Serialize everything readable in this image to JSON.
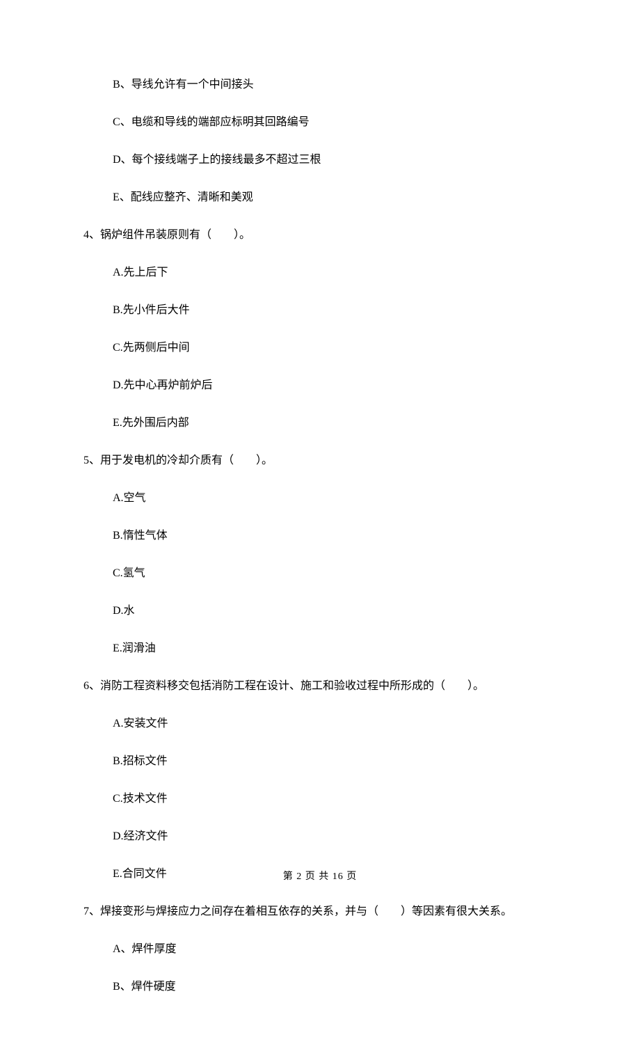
{
  "options_top": [
    "B、导线允许有一个中间接头",
    "C、电缆和导线的端部应标明其回路编号",
    "D、每个接线端子上的接线最多不超过三根",
    "E、配线应整齐、清晰和美观"
  ],
  "q4": {
    "text": "4、锅炉组件吊装原则有（　　）。",
    "opts": [
      "A.先上后下",
      "B.先小件后大件",
      "C.先两侧后中间",
      "D.先中心再炉前炉后",
      "E.先外围后内部"
    ]
  },
  "q5": {
    "text": "5、用于发电机的冷却介质有（　　）。",
    "opts": [
      "A.空气",
      "B.惰性气体",
      "C.氢气",
      "D.水",
      "E.润滑油"
    ]
  },
  "q6": {
    "text": "6、消防工程资料移交包括消防工程在设计、施工和验收过程中所形成的（　　）。",
    "opts": [
      "A.安装文件",
      "B.招标文件",
      "C.技术文件",
      "D.经济文件",
      "E.合同文件"
    ]
  },
  "q7": {
    "text": "7、焊接变形与焊接应力之间存在着相互依存的关系，并与（　　）等因素有很大关系。",
    "opts": [
      "A、焊件厚度",
      "B、焊件硬度"
    ]
  },
  "footer": "第 2 页 共 16 页"
}
